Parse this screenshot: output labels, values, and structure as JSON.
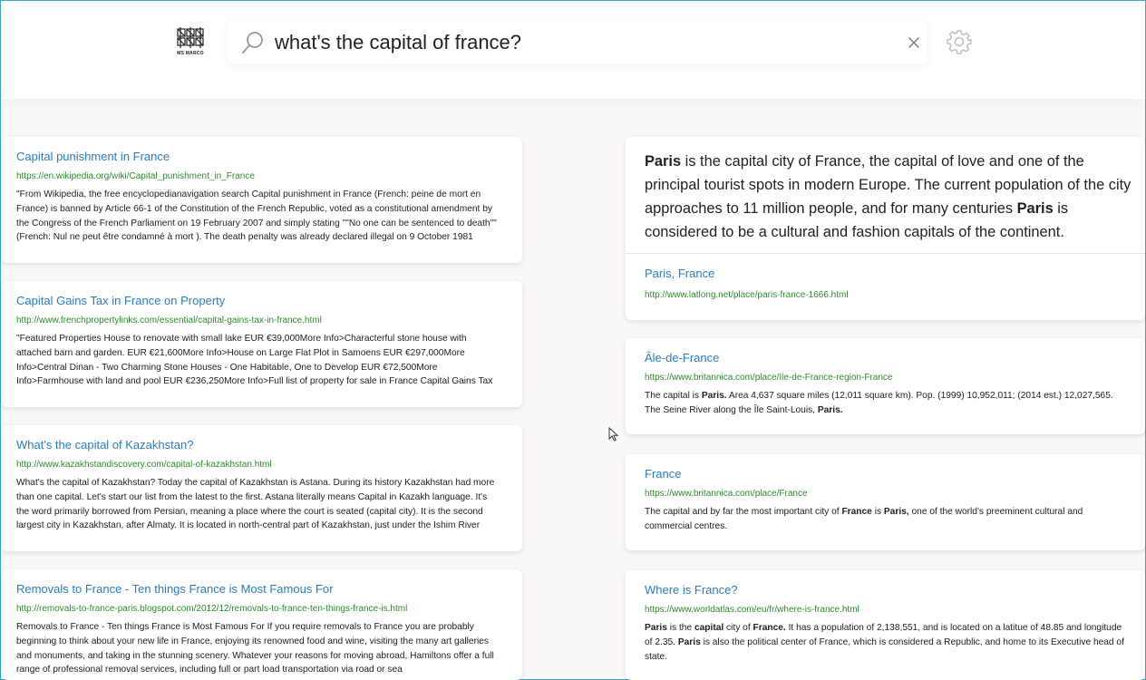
{
  "logo": {
    "text": "MS MARCO"
  },
  "search": {
    "query": "what's the capital of france?"
  },
  "results_left": [
    {
      "title": "Capital punishment in France",
      "url": "https://en.wikipedia.org/wiki/Capital_punishment_in_France",
      "snippet": "\"From Wikipedia, the free encyclopedianavigation search Capital punishment in France (French: peine de mort en France) is banned by Article 66-1 of the Constitution of the French Republic, voted as a constitutional amendment by the Congress of the French Parliament on 19 February 2007 and simply stating \"\"No one can be sentenced to death\"\" (French: Nul ne peut être condamné à mort ). The death penalty was already declared illegal on 9 October 1981"
    },
    {
      "title": "Capital Gains Tax in France on Property",
      "url": "http://www.frenchpropertylinks.com/essential/capital-gains-tax-in-france.html",
      "snippet": "\"Featured Properties House to renovate with small lake EUR €39,000More Info>Characterful stone house with attached barn and garden. EUR €21,600More Info>House on Large Flat Plot in Samoens EUR €297,000More Info>Central Dinan - Two Charming Stone Houses - One Habitable, One to Develop EUR €72,500More Info>Farmhouse with land and pool EUR €236,250More Info>Full list of property for sale in France Capital Gains Tax"
    },
    {
      "title": "What's the capital of Kazakhstan?",
      "url": "http://www.kazakhstandiscovery.com/capital-of-kazakhstan.html",
      "snippet": "What's the capital of Kazakhstan? Today the capital of Kazakhstan is Astana. During its history Kazakhstan had more than one capital. Let's start our list from the latest to the first. Astana literally means Capital in Kazakh language. It's the word primarily borrowed from Persian, meaning a place where the court is seated (capital city). It is the second largest city in Kazakhstan, after Almaty. It is located in north-central part of Kazakhstan, just under the Ishim River"
    },
    {
      "title": "Removals to France - Ten things France is Most Famous For",
      "url": "http://removals-to-france-paris.blogspot.com/2012/12/removals-to-france-ten-things-france-is.html",
      "snippet": "Removals to France - Ten things France is Most Famous For If you require removals to France you are probably beginning to think about your new life in France, enjoying its renowned food and wine, visiting the many art galleries and monuments, and taking in the stunning scenery. Whatever your reasons for moving abroad, Hamiltons offer a full range of professional removal services, including full or part load transportation via road or sea"
    }
  ],
  "answer": {
    "parts": [
      "Paris",
      " is the capital city of France, the capital of love and one of the principal tourist spots in modern Europe. The current population of the city approaches to 11 million people, and for many centuries ",
      "Paris",
      " is considered to be a cultural and fashion capitals of the continent."
    ],
    "source_title": "Paris, France",
    "source_url": "http://www.latlong.net/place/paris-france-1666.html"
  },
  "results_right": [
    {
      "title": "Ȃle-de-France",
      "url": "https://www.britannica.com/place/Ile-de-France-region-France",
      "snippet_parts": [
        "The capital is ",
        "Paris.",
        " Area 4,637 square miles (12,011 square km). Pop. (1999) 10,952,011; (2014 est.) 12,027,565. The Seine River along the Île Saint-Louis, ",
        "Paris."
      ]
    },
    {
      "title": "France",
      "url": "https://www.britannica.com/place/France",
      "snippet_parts": [
        "The capital and by far the most important city of ",
        "France",
        " is ",
        "Paris,",
        " one of the world's preeminent cultural and commercial centres."
      ]
    },
    {
      "title": "Where is France?",
      "url": "https://www.worldatlas.com/eu/fr/where-is-france.html",
      "snippet_parts": [
        "Paris",
        " is the ",
        "capital",
        " city of ",
        "France.",
        " It has a population of 2,138,551, and is located on a latitue of 48.85 and longitude of 2.35. ",
        "Paris",
        " is also the political center of France, which is considered a Republic, and home to its Executive head of state."
      ]
    }
  ],
  "icons": {
    "logo": "ms-marco-logo-icon",
    "search": "search-icon",
    "clear": "close-icon",
    "settings": "gear-icon",
    "cursor": "mouse-pointer-icon"
  }
}
